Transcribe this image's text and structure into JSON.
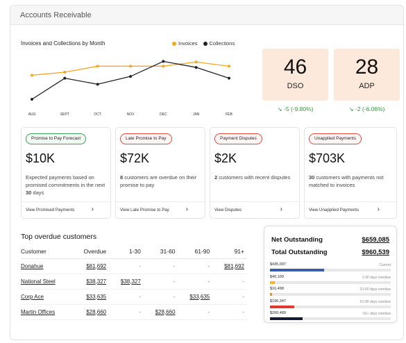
{
  "page_title": "Accounts Receivable",
  "chart_data": {
    "type": "line",
    "title": "Invoices and Collections by Month",
    "categories": [
      "AUG",
      "SEPT",
      "OCT",
      "NOV",
      "DEC",
      "JAN",
      "FEB"
    ],
    "series": [
      {
        "name": "Invoices",
        "color": "#f5a623",
        "values": [
          75,
          80,
          90,
          90,
          90,
          97,
          90
        ]
      },
      {
        "name": "Collections",
        "color": "#222222",
        "values": [
          35,
          70,
          60,
          73,
          98,
          88,
          70
        ]
      }
    ],
    "ylim": [
      20,
      110
    ],
    "grid": false,
    "legend": "top-right"
  },
  "kpis": [
    {
      "value": "46",
      "label": "DSO",
      "delta": "↘ -5 (-9.80%)"
    },
    {
      "value": "28",
      "label": "ADP",
      "delta": "↘ -2 (-6.06%)"
    }
  ],
  "cards": [
    {
      "pill": "Promise to Pay Forecast",
      "amount": "$10K",
      "desc_bold": "",
      "desc": "Expected payments based on promised commitments in the next ",
      "desc_tail_bold": "30",
      "desc_tail": " days",
      "link": "View Promised Payments",
      "arrow": "›"
    },
    {
      "pill": "Late Promise to Pay",
      "amount": "$72K",
      "desc_bold": "8",
      "desc": " customers are overdue on their promise to pay",
      "desc_tail_bold": "",
      "desc_tail": "",
      "link": "View Late Promise to Pay",
      "arrow": "›"
    },
    {
      "pill": "Payment Disputes",
      "amount": "$2K",
      "desc_bold": "2",
      "desc": " customers with recent disputes",
      "desc_tail_bold": "",
      "desc_tail": "",
      "link": "View Disputes",
      "arrow": "›"
    },
    {
      "pill": "Unapplied Payments",
      "amount": "$703K",
      "desc_bold": "30",
      "desc": " customers with payments not matched to invoices",
      "desc_tail_bold": "",
      "desc_tail": "",
      "link": "View Unapplied Payments",
      "arrow": "›"
    }
  ],
  "overdue": {
    "title": "Top overdue customers",
    "headers": [
      "Customer",
      "Overdue",
      "1-30",
      "31-60",
      "61-90",
      "91+"
    ],
    "rows": [
      [
        "Donahue",
        "$81,692",
        "-",
        "-",
        "-",
        "$81,692"
      ],
      [
        "National Steel",
        "$38,327",
        "$38,327",
        "-",
        "-",
        "-"
      ],
      [
        "Corp Ace",
        "$33,635",
        "-",
        "-",
        "$33,635",
        "-"
      ],
      [
        "Martin Offices",
        "$28,660",
        "-",
        "$28,660",
        "-",
        "-"
      ]
    ]
  },
  "summary": {
    "net_label": "Net Outstanding",
    "net_value": "$659,085",
    "total_label": "Total Outstanding",
    "total_value": "$960,539",
    "aging": [
      {
        "amount": "$435,097",
        "bucket": "Current",
        "color": "#3b5bab",
        "share": 0.45
      },
      {
        "amount": "$40,109",
        "bucket": "1-30 days overdue",
        "color": "#f5b82e",
        "share": 0.04
      },
      {
        "amount": "$16,498",
        "bucket": "31-60 days overdue",
        "color": "#f08a2a",
        "share": 0.02
      },
      {
        "amount": "$190,347",
        "bucket": "61-90 days overdue",
        "color": "#e03a2e",
        "share": 0.2
      },
      {
        "amount": "$260,489",
        "bucket": "91+ days overdue",
        "color": "#141a36",
        "share": 0.27
      }
    ]
  }
}
